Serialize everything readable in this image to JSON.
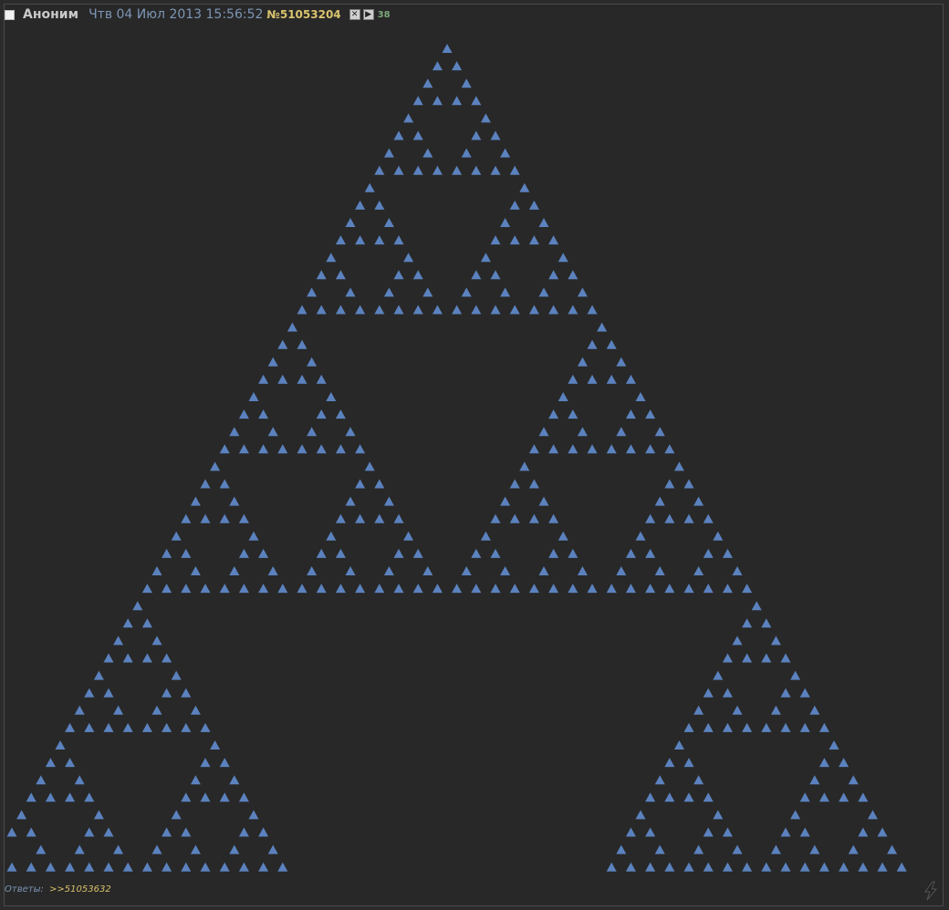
{
  "post": {
    "author": "Аноним",
    "date": "Чтв 04 Июл 2013 15:56:52",
    "number_prefix": "№",
    "number": "51053204",
    "close_button_glyph": "✕",
    "play_button_glyph": "▶",
    "reply_count": "38",
    "replies_label": "Ответы:",
    "reply_link": ">>51053632",
    "triangle_color": "#5b82be",
    "background_color": "#282828",
    "icons": {
      "checkbox": "checkbox-icon",
      "close": "close-icon",
      "play": "play-icon",
      "bolt": "lightning-icon"
    }
  }
}
